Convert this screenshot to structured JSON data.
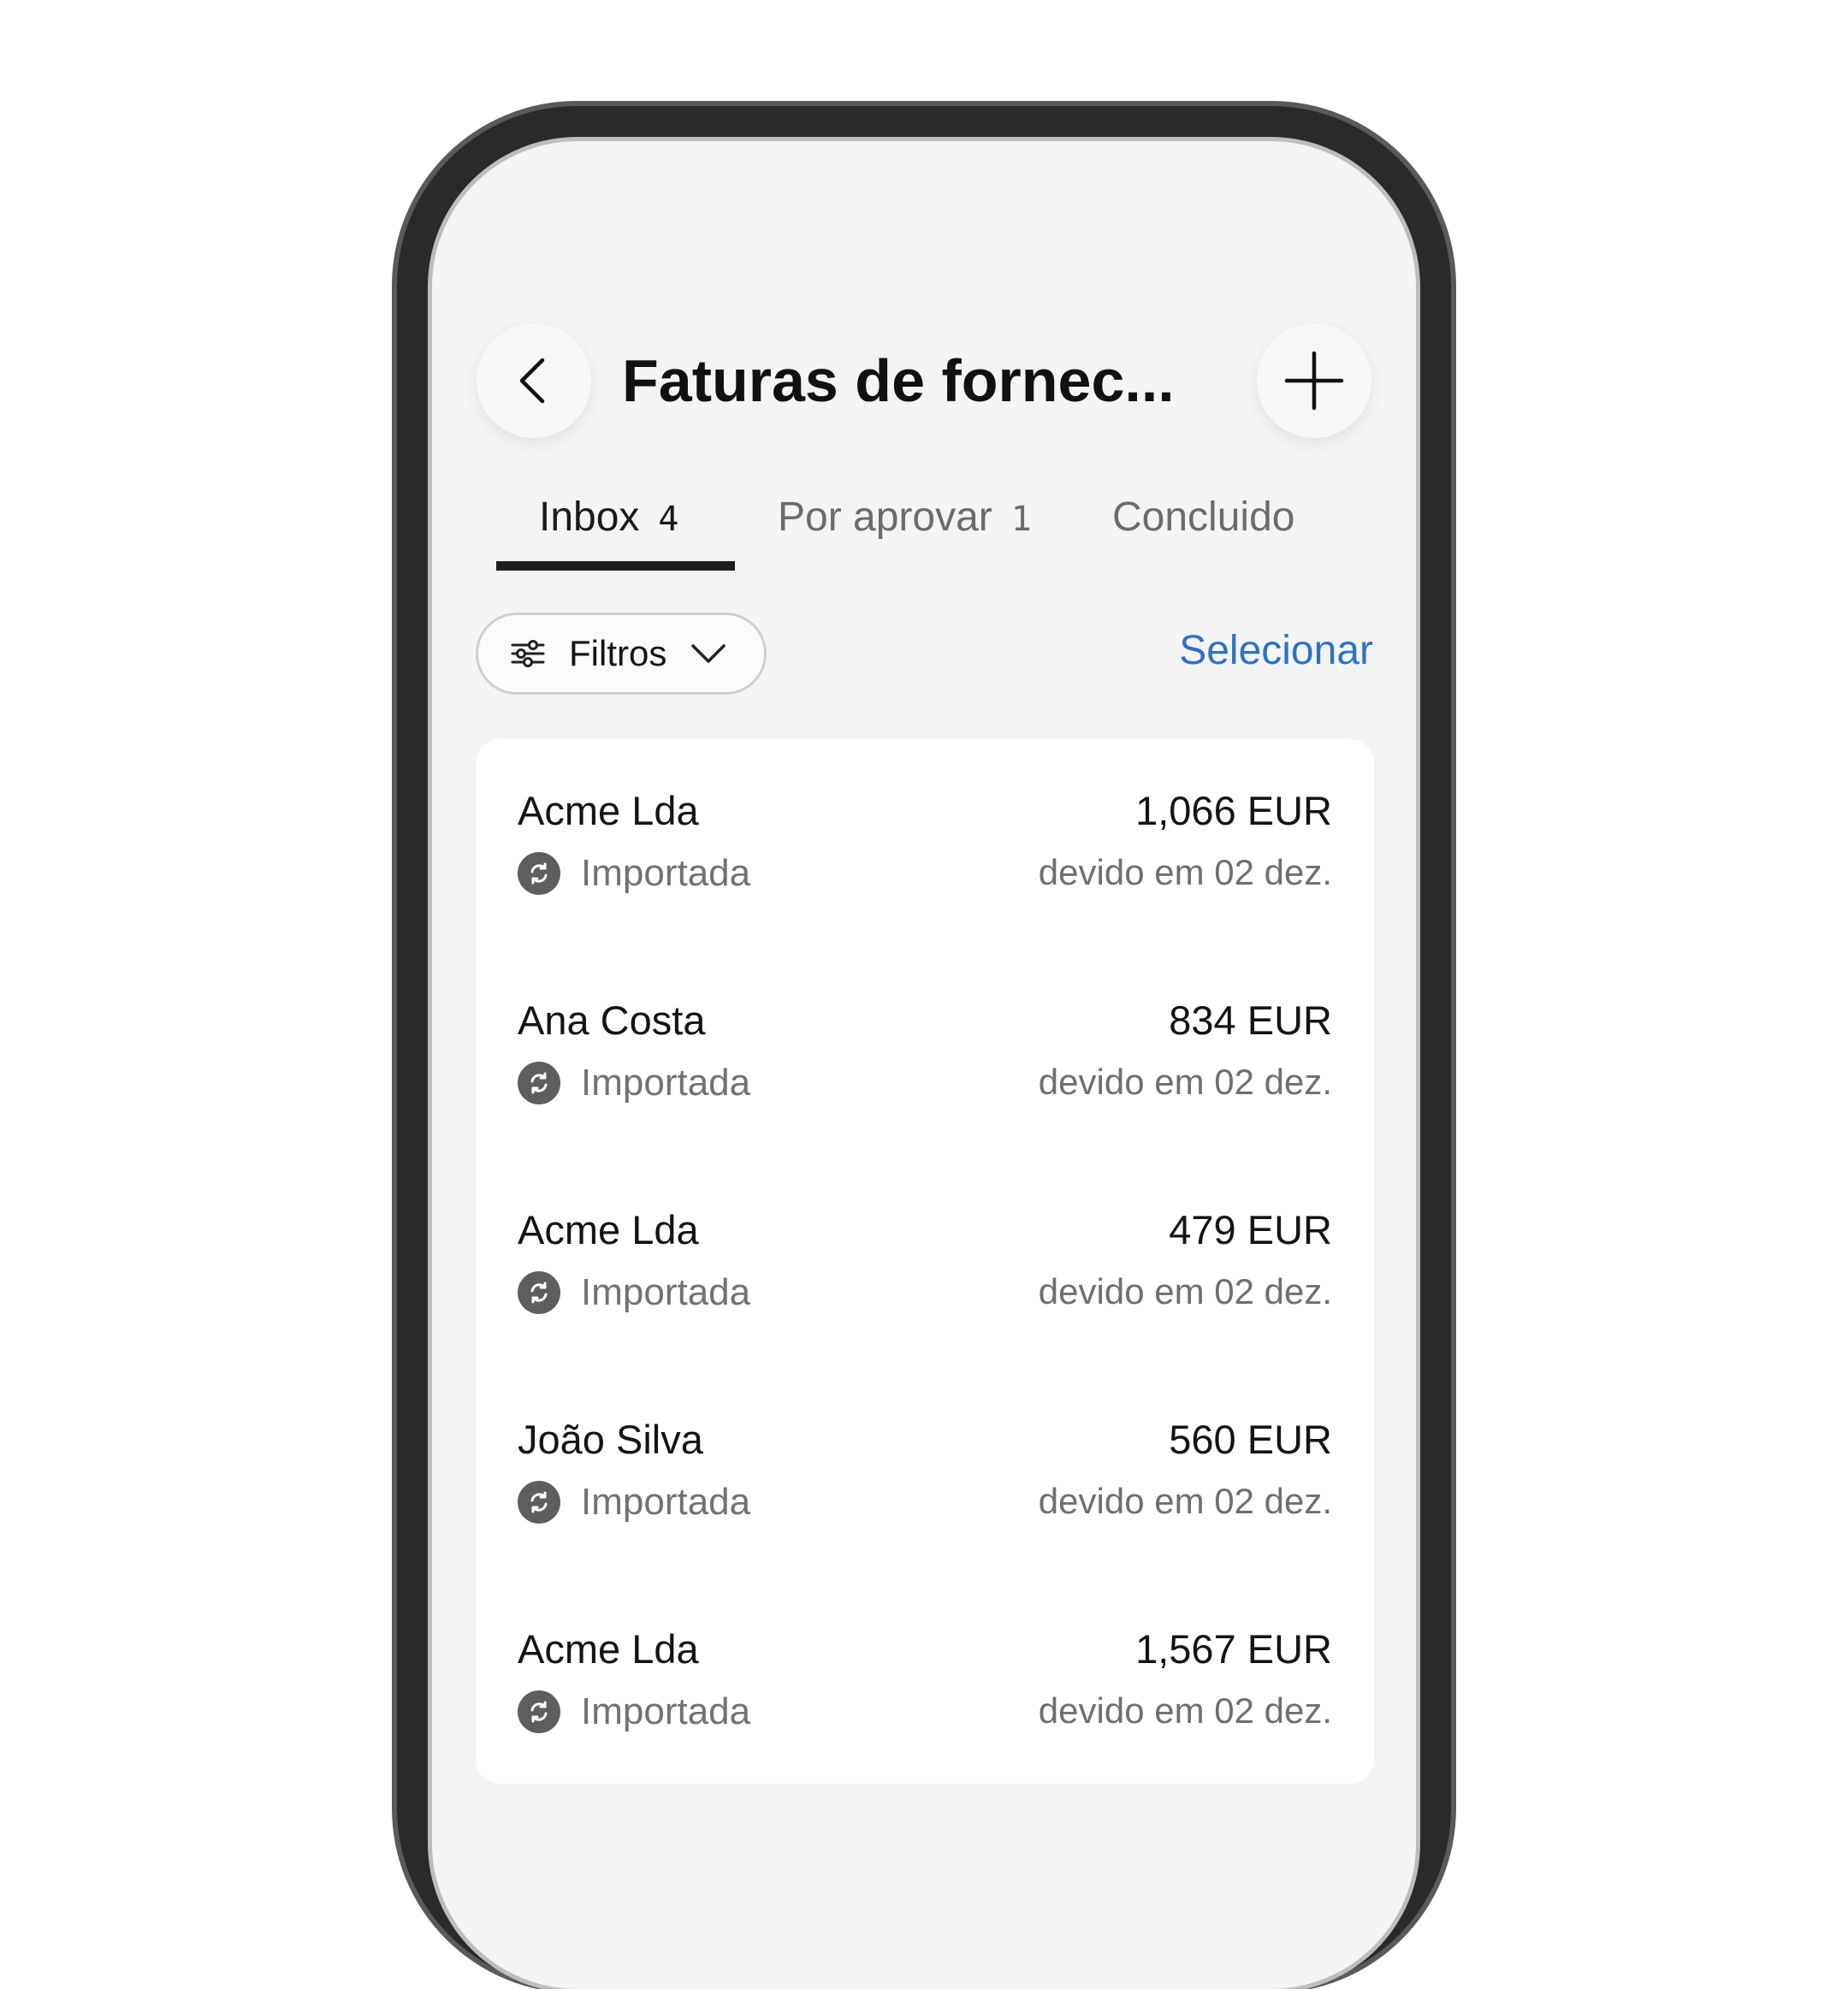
{
  "header": {
    "title": "Faturas de fornec...",
    "back_icon": "chevron-left-icon",
    "add_icon": "plus-icon"
  },
  "tabs": [
    {
      "label": "Inbox",
      "count": "4",
      "active": true
    },
    {
      "label": "Por aprovar",
      "count": "1",
      "active": false
    },
    {
      "label": "Concluido",
      "count": "",
      "active": false
    }
  ],
  "toolbar": {
    "filter_label": "Filtros",
    "filter_icon": "sliders-icon",
    "dropdown_icon": "chevron-down-icon",
    "select_label": "Selecionar"
  },
  "invoices": [
    {
      "supplier": "Acme Lda",
      "status": "Importada",
      "amount": "1,066 EUR",
      "due": "devido em 02 dez."
    },
    {
      "supplier": "Ana Costa",
      "status": "Importada",
      "amount": "834 EUR",
      "due": "devido em 02 dez."
    },
    {
      "supplier": "Acme Lda",
      "status": "Importada",
      "amount": "479 EUR",
      "due": "devido em 02 dez."
    },
    {
      "supplier": "João Silva",
      "status": "Importada",
      "amount": "560 EUR",
      "due": "devido em 02 dez."
    },
    {
      "supplier": "Acme Lda",
      "status": "Importada",
      "amount": "1,567 EUR",
      "due": "devido em 02 dez."
    }
  ],
  "colors": {
    "accent": "#2e72c5",
    "screen_background": "#f4f4f4",
    "card_background": "#ffffff",
    "status_icon": "#5e5e5e"
  }
}
